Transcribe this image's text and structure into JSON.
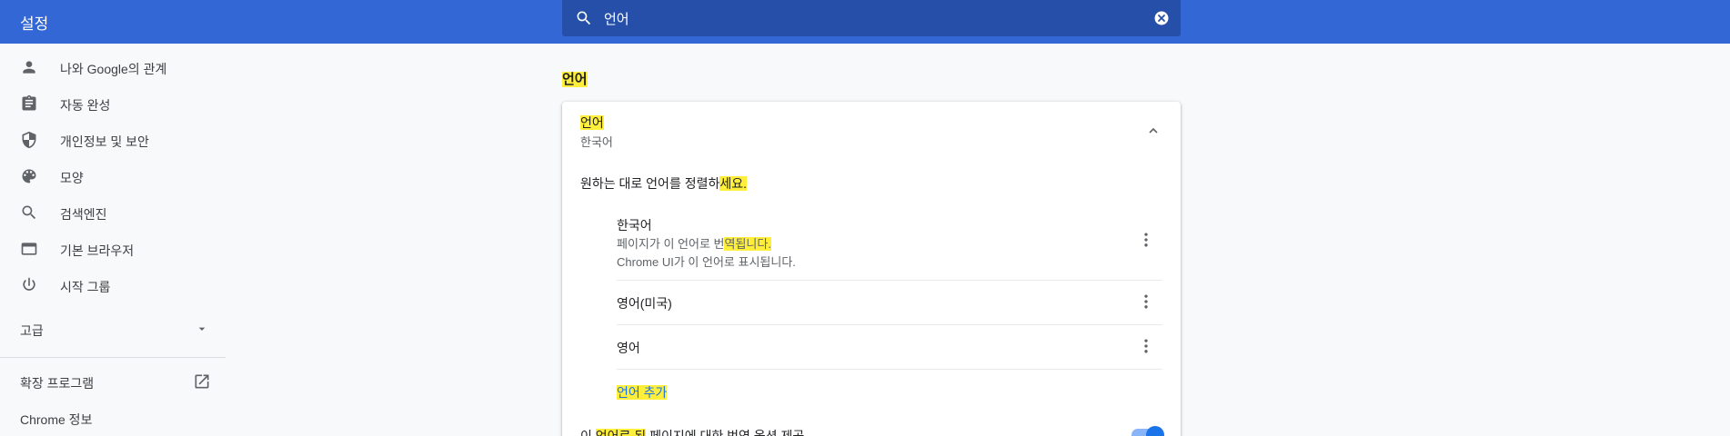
{
  "header": {
    "title": "설정",
    "search_value": "언어"
  },
  "sidebar": {
    "items": [
      {
        "label": "나와 Google의 관계",
        "icon": "person-icon"
      },
      {
        "label": "자동 완성",
        "icon": "clipboard-icon"
      },
      {
        "label": "개인정보 및 보안",
        "icon": "shield-icon"
      },
      {
        "label": "모양",
        "icon": "palette-icon"
      },
      {
        "label": "검색엔진",
        "icon": "search-icon"
      },
      {
        "label": "기본 브라우저",
        "icon": "browser-icon"
      },
      {
        "label": "시작 그룹",
        "icon": "power-icon"
      }
    ],
    "advanced_label": "고급",
    "extensions_label": "확장 프로그램",
    "about_label": "Chrome 정보"
  },
  "main": {
    "section_title": "언어",
    "card": {
      "header_title": "언어",
      "header_subtitle": "한국어",
      "instruction_a": "원하는 대로 언어를 정렬하",
      "instruction_b": "세요.",
      "languages": [
        {
          "name": "한국어",
          "detail1_a": "페이지가 이 언어로 번",
          "detail1_b": "역됩니다.",
          "detail2": "Chrome UI가 이 언어로 표시됩니다."
        },
        {
          "name": "영어(미국)"
        },
        {
          "name": "영어"
        }
      ],
      "add_language": "언어 추가",
      "translate_a": "이 ",
      "translate_b": "언어로 된",
      "translate_c": " 페이지에 대한 번역 옵션 제공"
    }
  },
  "colors": {
    "topbar": "#3367d6",
    "search_bg": "#254fa8",
    "highlight": "#ffef3a",
    "accent": "#1a73e8"
  }
}
